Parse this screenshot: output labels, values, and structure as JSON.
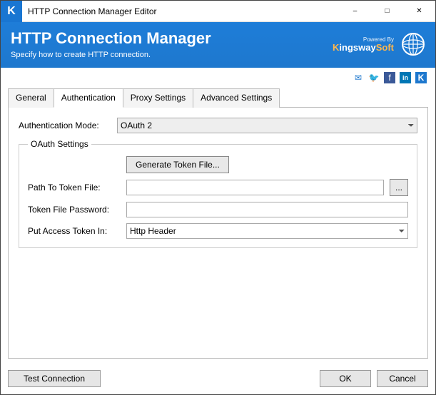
{
  "window": {
    "title": "HTTP Connection Manager Editor",
    "logo_letter": "K"
  },
  "banner": {
    "title": "HTTP Connection Manager",
    "subtitle": "Specify how to create HTTP connection.",
    "brand_top": "Powered By",
    "brand_main_1": "K",
    "brand_main_2": "ingsway",
    "brand_main_3": "Soft"
  },
  "social": {
    "mail": "✉",
    "twitter": "🐦",
    "facebook": "f",
    "linkedin": "in",
    "k": "K"
  },
  "tabs": {
    "general": "General",
    "authentication": "Authentication",
    "proxy": "Proxy Settings",
    "advanced": "Advanced Settings"
  },
  "auth": {
    "mode_label": "Authentication Mode:",
    "mode_value": "OAuth 2",
    "oauth_legend": "OAuth Settings",
    "generate_btn": "Generate Token File...",
    "path_label": "Path To Token File:",
    "path_value": "",
    "browse": "...",
    "password_label": "Token File Password:",
    "password_value": "",
    "put_token_label": "Put Access Token In:",
    "put_token_value": "Http Header"
  },
  "footer": {
    "test": "Test Connection",
    "ok": "OK",
    "cancel": "Cancel"
  }
}
